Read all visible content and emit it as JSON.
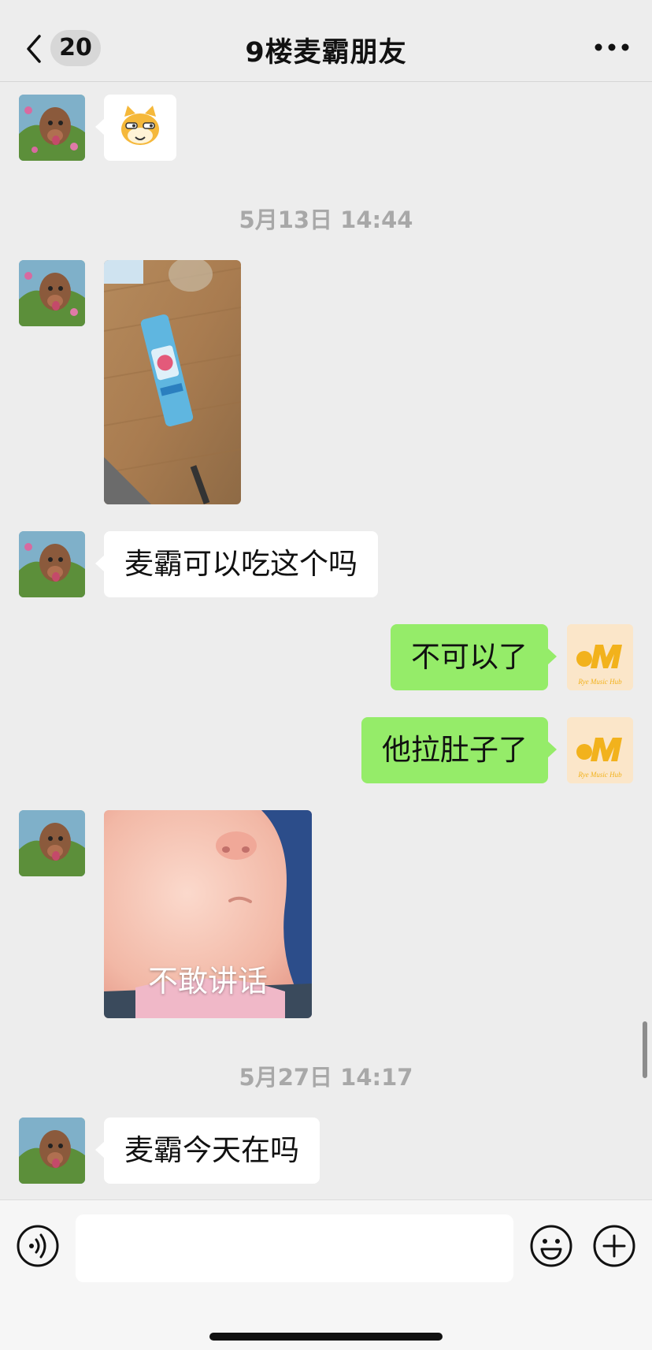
{
  "header": {
    "unread_count": "20",
    "title": "9楼麦霸朋友"
  },
  "messages": [
    {
      "type": "sticker",
      "side": "left",
      "icon": "doge-cat-icon"
    },
    {
      "type": "timestamp",
      "text": "5月13日 14:44"
    },
    {
      "type": "image",
      "side": "left",
      "description_icon": "snack-photo"
    },
    {
      "type": "text",
      "side": "left",
      "text": "麦霸可以吃这个吗"
    },
    {
      "type": "text",
      "side": "right",
      "text": "不可以了"
    },
    {
      "type": "text",
      "side": "right",
      "text": "他拉肚子了"
    },
    {
      "type": "image",
      "side": "left",
      "caption": "不敢讲话"
    },
    {
      "type": "timestamp",
      "text": "5月27日 14:17"
    },
    {
      "type": "text",
      "side": "left",
      "text": "麦霸今天在吗"
    }
  ],
  "avatars": {
    "left_icon": "dog-avatar",
    "right_icon": "music-logo-avatar",
    "right_logo_text": "Rye Music Hub"
  },
  "input": {
    "value": "",
    "placeholder": ""
  },
  "colors": {
    "background": "#ededed",
    "bubble_self": "#95ec69",
    "bubble_other": "#ffffff",
    "timestamp": "#a8a8a8",
    "logo": "#f2b21c"
  }
}
